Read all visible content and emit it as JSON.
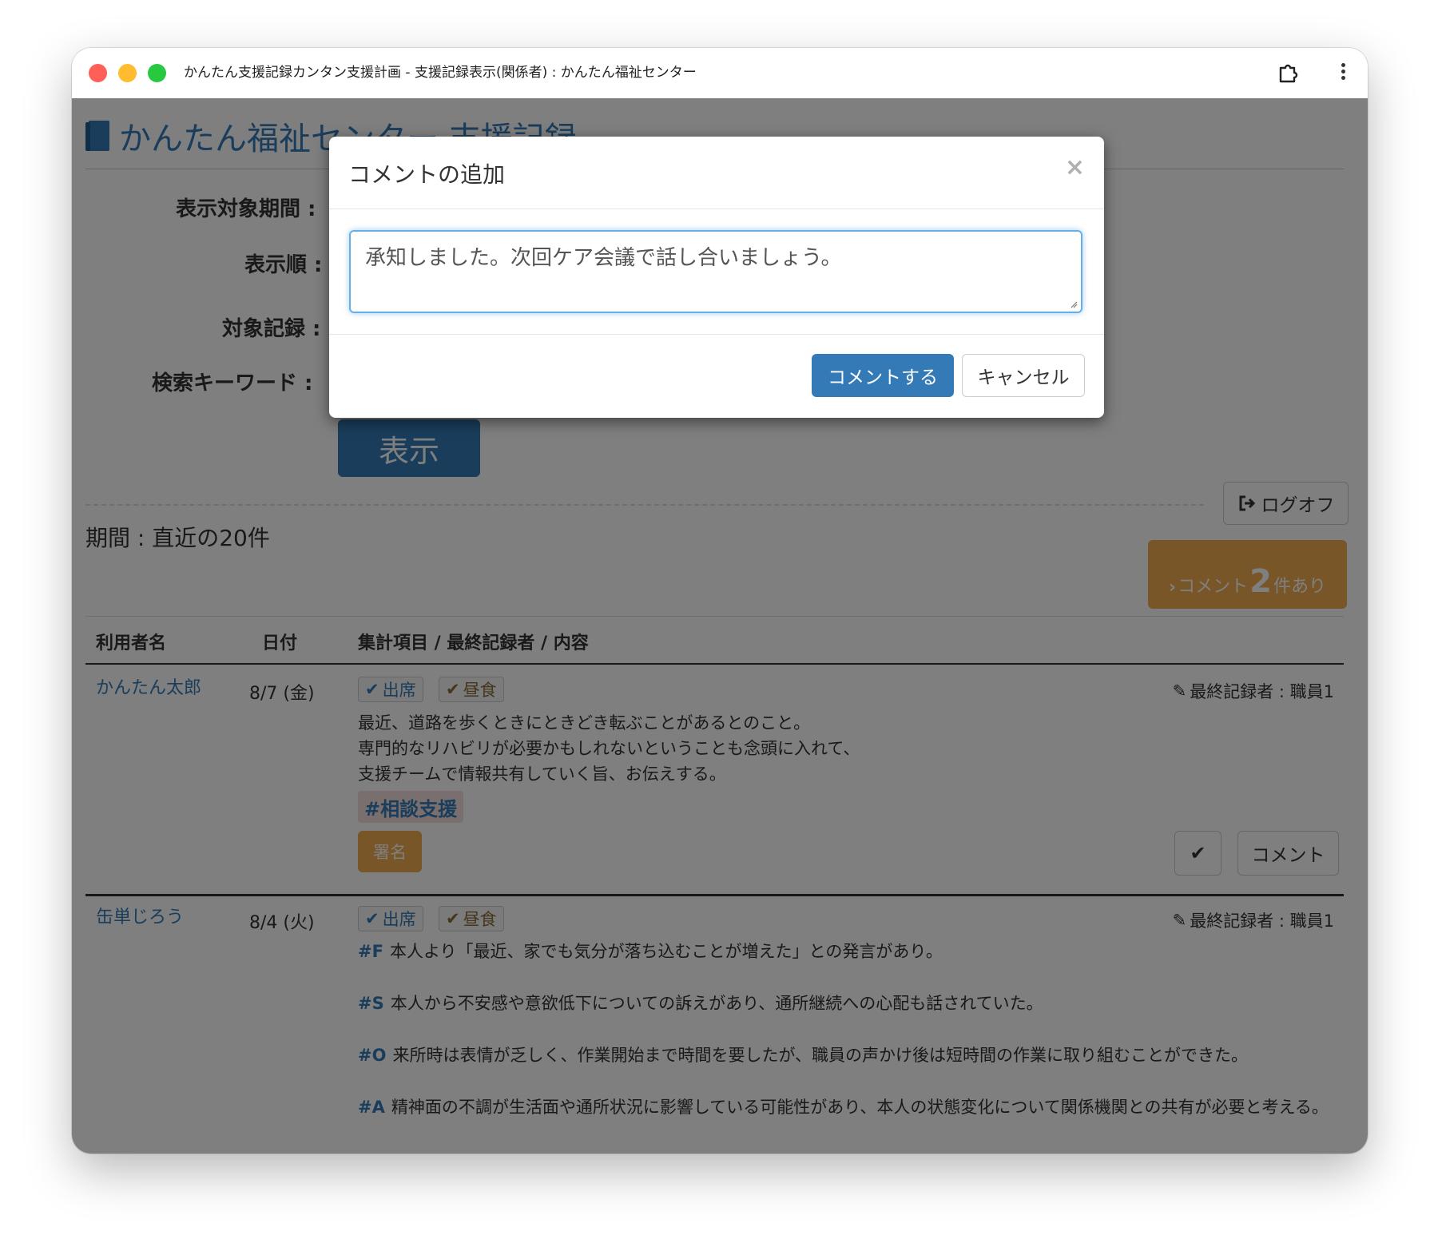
{
  "window": {
    "title": "かんたん支援記録カンタン支援計画 - 支援記録表示(関係者) : かんたん福祉センター"
  },
  "header": {
    "title": "かんたん福祉センター 支援記録"
  },
  "form": {
    "period_label": "表示対象期間 :",
    "order_label": "表示順 :",
    "target_label": "対象記録 :",
    "keyword_label": "検索キーワード :",
    "show_button": "表示"
  },
  "logoff": "ログオフ",
  "period_text": "期間 : 直近の20件",
  "comment_badge": {
    "prefix": "コメント",
    "count": "2",
    "suffix": "件あり"
  },
  "table": {
    "headers": [
      "利用者名",
      "日付",
      "集計項目 / 最終記録者 / 内容"
    ],
    "rows": [
      {
        "user": "かんたん太郎",
        "date": "8/7 (金)",
        "tags": [
          "出席",
          "昼食"
        ],
        "editor": "最終記録者 : 職員1",
        "lines": [
          "最近、道路を歩くときにときどき転ぶことがあるとのこと。",
          "専門的なリハビリが必要かもしれないということも念頭に入れて、",
          "支援チームで情報共有していく旨、お伝えする。"
        ],
        "hashtag": "#相談支援",
        "sign_label": "署名",
        "comment_label": "コメント"
      },
      {
        "user": "缶単じろう",
        "date": "8/4 (火)",
        "tags": [
          "出席",
          "昼食"
        ],
        "editor": "最終記録者 : 職員1",
        "soap": [
          {
            "key": "#F",
            "text": "本人より「最近、家でも気分が落ち込むことが増えた」との発言があり。"
          },
          {
            "key": "#S",
            "text": "本人から不安感や意欲低下についての訴えがあり、通所継続への心配も話されていた。"
          },
          {
            "key": "#O",
            "text": "来所時は表情が乏しく、作業開始まで時間を要したが、職員の声かけ後は短時間の作業に取り組むことができた。"
          },
          {
            "key": "#A",
            "text": "精神面の不調が生活面や通所状況に影響している可能性があり、本人の状態変化について関係機関との共有が必要と考える。"
          }
        ]
      }
    ]
  },
  "modal": {
    "title": "コメントの追加",
    "close": "×",
    "text": "承知しました。次回ケア会議で話し合いましょう。",
    "submit": "コメントする",
    "cancel": "キャンセル"
  }
}
